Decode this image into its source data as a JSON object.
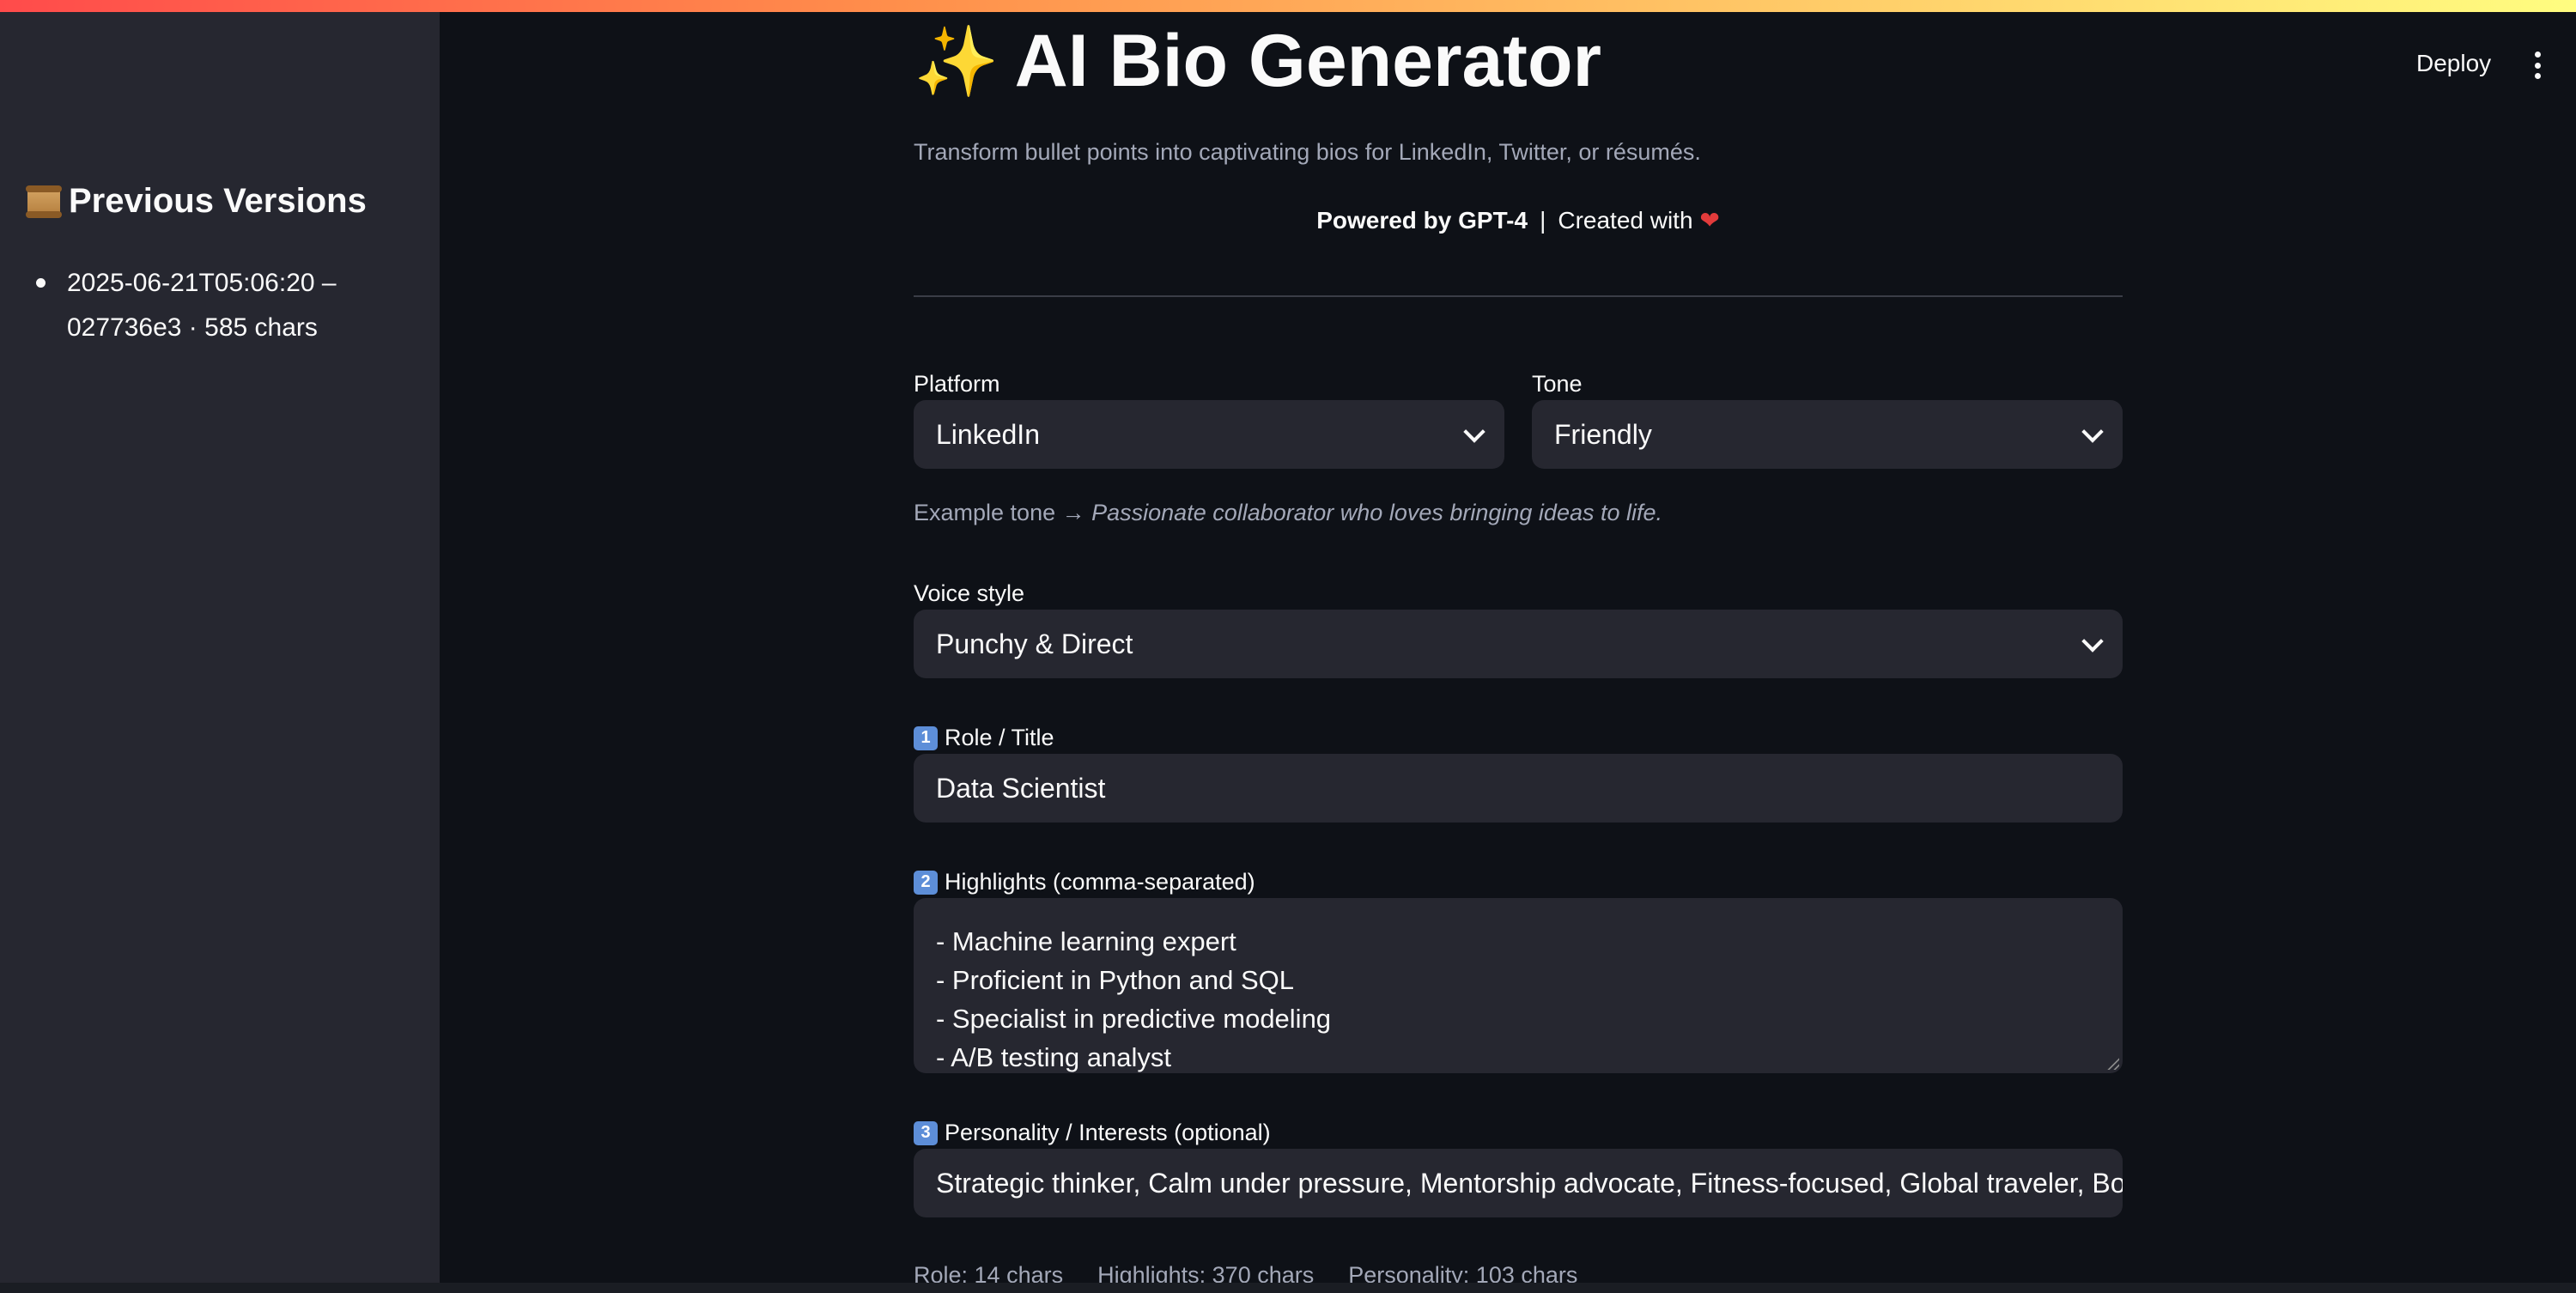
{
  "header": {
    "deploy_label": "Deploy",
    "menu_icon": "kebab-menu-icon"
  },
  "sidebar": {
    "heading": "Previous Versions",
    "heading_icon": "scroll-icon",
    "versions": [
      {
        "line1": "2025-06-21T05:06:20 –",
        "line2": "027736e3 · 585 chars"
      }
    ]
  },
  "main": {
    "title": "AI Bio Generator",
    "title_icon": "sparkles-icon",
    "subtitle": "Transform bullet points into captivating bios for LinkedIn, Twitter, or résumés.",
    "powered_by": "Powered by GPT-4",
    "separator": "|",
    "created_with": "Created with",
    "heart_icon": "heart-icon",
    "platform": {
      "label": "Platform",
      "value": "LinkedIn"
    },
    "tone": {
      "label": "Tone",
      "value": "Friendly"
    },
    "example_tone": {
      "prefix": "Example tone →",
      "text": "Passionate collaborator who loves bringing ideas to life."
    },
    "voice_style": {
      "label": "Voice style",
      "value": "Punchy & Direct"
    },
    "role": {
      "number": "1",
      "label": "Role / Title",
      "value": "Data Scientist"
    },
    "highlights": {
      "number": "2",
      "label": "Highlights (comma-separated)",
      "lines": [
        "- Machine learning expert",
        "- Proficient in Python and SQL",
        "- Specialist in predictive modeling",
        "- A/B testing analyst"
      ]
    },
    "personality": {
      "number": "3",
      "label": "Personality / Interests (optional)",
      "value": "Strategic thinker, Calm under pressure, Mentorship advocate, Fitness-focused, Global traveler, Bookwo"
    },
    "counts": {
      "role": "Role: 14 chars",
      "highlights": "Highlights: 370 chars",
      "personality": "Personality: 103 chars"
    }
  },
  "colors": {
    "background": "#0e1117",
    "sidebar": "#262730",
    "input": "#262730",
    "muted_text": "#a3a8b8",
    "accent_gradient_start": "#ff4b4b",
    "accent_gradient_end": "#fffd80"
  }
}
